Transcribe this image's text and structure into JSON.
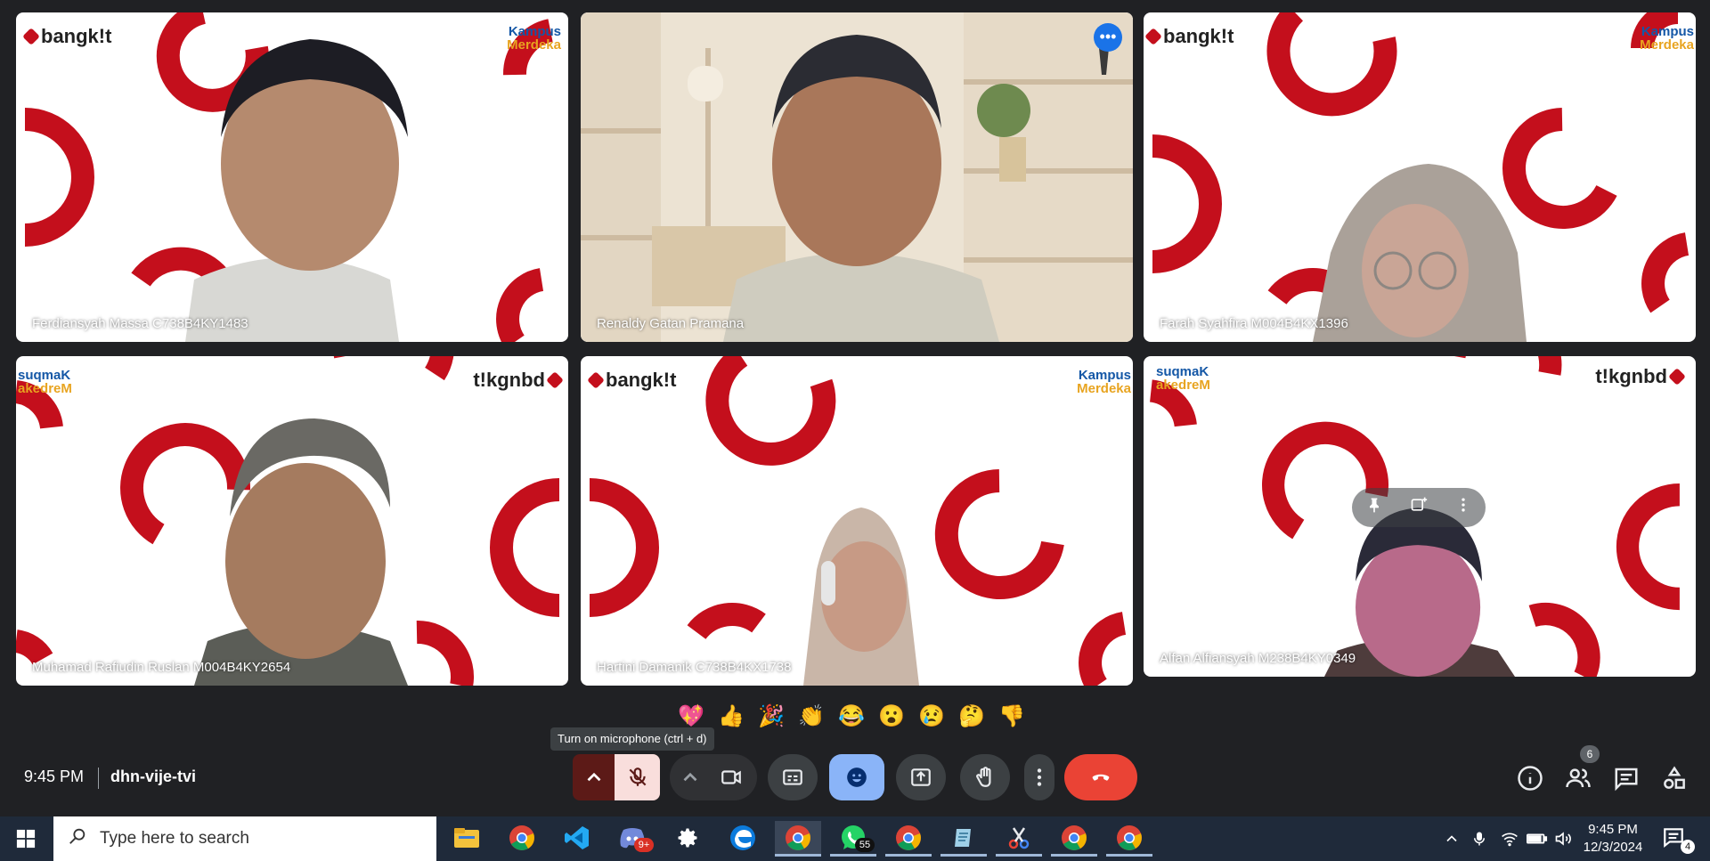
{
  "colors": {
    "brand_red": "#c40f1c",
    "accent_blue": "#8ab4f8",
    "end_call_red": "#ea4335",
    "mic_off_bg": "#f9dedc"
  },
  "participants": [
    {
      "name": "Ferdiansyah Massa C738B4KY1483",
      "background": "bangkit-red-pattern"
    },
    {
      "name": "Renaldy Gatan Pramana",
      "background": "room-bookshelf",
      "active": true
    },
    {
      "name": "Farah Syahfira M004B4KX1396",
      "background": "bangkit-red-pattern"
    },
    {
      "name": "Muhamad Rafiudin Ruslan M004B4KY2654",
      "background": "bangkit-red-pattern-mirrored"
    },
    {
      "name": "Hartini Damanik C738B4KX1738",
      "background": "bangkit-red-pattern"
    },
    {
      "name": "Alfan Alfiansyah M238B4KY0349",
      "background": "bangkit-red-pattern-mirrored"
    }
  ],
  "logos": {
    "bangkit": "bangk!t",
    "bangkit_mirrored": "t!kgnbd",
    "kampus_line1": "Kampus",
    "kampus_line2": "Merdeka",
    "kampus_line1_mirrored": "suqmaK",
    "kampus_line2_mirrored": "akedreM"
  },
  "tile_more_label": "•••",
  "emojis": [
    "💖",
    "👍",
    "🎉",
    "👏",
    "😂",
    "😮",
    "😢",
    "🤔",
    "👎"
  ],
  "tooltip": "Turn on microphone (ctrl + d)",
  "meeting": {
    "time": "9:45 PM",
    "code": "dhn-vije-tvi"
  },
  "controls": {
    "mic": "mic-off-icon",
    "camera": "camera-icon",
    "captions": "captions-icon",
    "reactions": "emoji-icon",
    "present": "present-icon",
    "raise_hand": "hand-icon",
    "more": "more-vert-icon",
    "end_call": "call-end-icon"
  },
  "side_panel": {
    "people_count": "6"
  },
  "taskbar": {
    "search_placeholder": "Type here to search",
    "apps": [
      {
        "name": "file-explorer",
        "open": false
      },
      {
        "name": "chrome",
        "open": false
      },
      {
        "name": "vscode",
        "open": false
      },
      {
        "name": "discord",
        "badge": "9+",
        "open": false
      },
      {
        "name": "settings",
        "open": false
      },
      {
        "name": "edge",
        "open": false
      },
      {
        "name": "chrome-profile-a",
        "open": true,
        "active": true
      },
      {
        "name": "whatsapp",
        "badge": "55",
        "open": true
      },
      {
        "name": "chrome-profile",
        "open": true
      },
      {
        "name": "notepad",
        "open": true
      },
      {
        "name": "snipping-tool",
        "open": true
      },
      {
        "name": "chrome-profile-a2",
        "open": true
      },
      {
        "name": "chrome-profile-a3",
        "open": true
      }
    ],
    "clock_time": "9:45 PM",
    "clock_date": "12/3/2024",
    "notification_count": "4"
  }
}
